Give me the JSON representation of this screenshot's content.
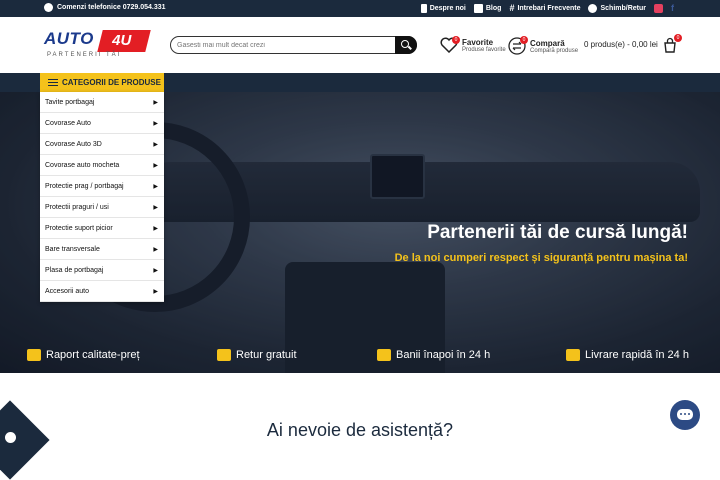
{
  "topbar": {
    "phone": "Comenzi telefonice 0729.054.331",
    "links": [
      "Despre noi",
      "Blog",
      "Intrebari Frecvente",
      "Schimb/Retur"
    ]
  },
  "logo": {
    "name": "AUTO",
    "badge": "4U",
    "tagline": "PARTENERII TĂI"
  },
  "search": {
    "placeholder": "Gasesti mai mult decat crezi"
  },
  "favorite": {
    "title": "Favorite",
    "subtitle": "Produse favorite",
    "count": "0"
  },
  "compare": {
    "title": "Compară",
    "subtitle": "Compară produse",
    "count": "0"
  },
  "cart": {
    "text": "0 produs(e) - 0,00 lei",
    "count": "0"
  },
  "categories": {
    "button_label": "CATEGORII DE PRODUSE",
    "items": [
      "Tavite portbagaj",
      "Covorase Auto",
      "Covorase Auto 3D",
      "Covorase auto mocheta",
      "Protectie prag / portbagaj",
      "Protectii praguri / usi",
      "Protectie suport picior",
      "Bare transversale",
      "Plasa de portbagaj",
      "Accesorii auto"
    ]
  },
  "hero": {
    "title": "Partenerii tăi de cursă lungă!",
    "subtitle": "De la noi cumperi respect și siguranță pentru mașina ta!"
  },
  "features": [
    "Raport calitate-preț",
    "Retur gratuit",
    "Banii înapoi în 24 h",
    "Livrare rapidă în 24 h"
  ],
  "assist": {
    "heading": "Ai nevoie de asistență?"
  },
  "colors": {
    "navy": "#1b2a3d",
    "yellow": "#f4c21b",
    "red": "#e31e24"
  }
}
